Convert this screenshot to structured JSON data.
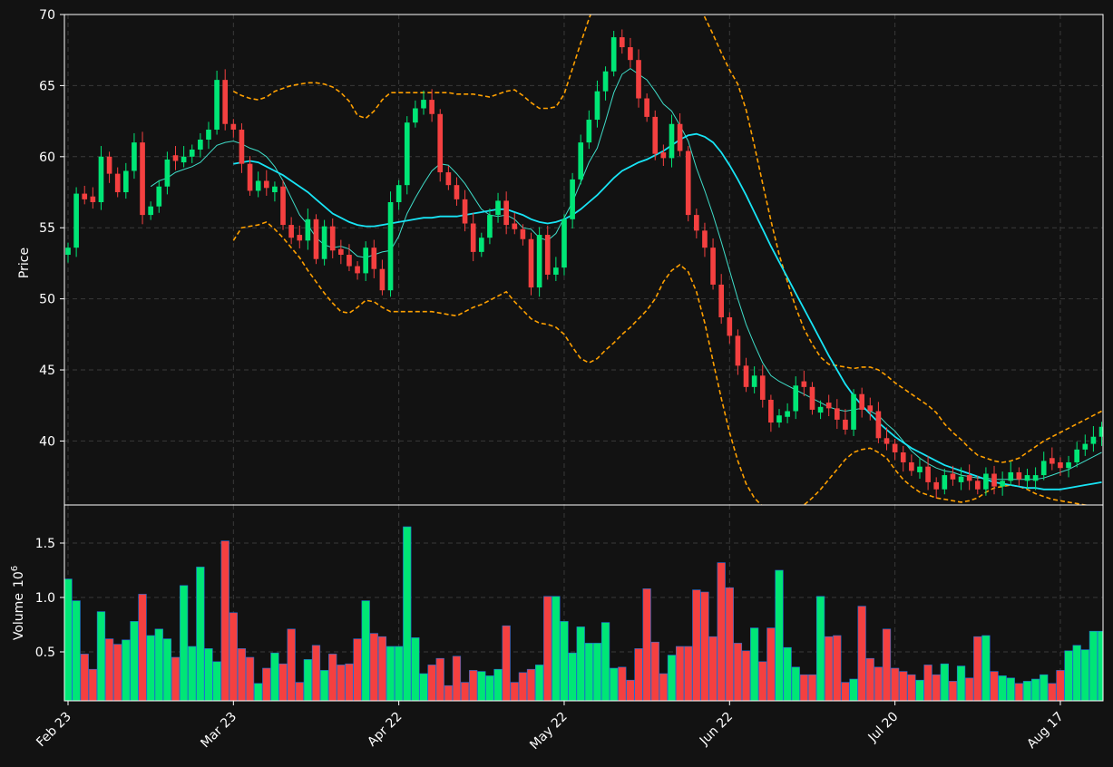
{
  "chart_data": {
    "type": "candlestick",
    "colors": {
      "background": "#121212",
      "axis": "#ffffff",
      "grid": "#3a3a3a",
      "up": "#00e676",
      "down": "#f44040",
      "ma_short": "#3fdcc8",
      "ma_long": "#18e4f5",
      "bands": "#ffa000",
      "volume_edge": "#1e6fd8"
    },
    "price_panel": {
      "ylabel": "Price",
      "ylim": [
        35.5,
        70
      ],
      "yticks": [
        40,
        45,
        50,
        55,
        60,
        65,
        70
      ]
    },
    "volume_panel": {
      "ylabel": "Volume",
      "unit_label": "10",
      "unit_exp": "6",
      "ylim": [
        0.05,
        1.85
      ],
      "yticks": [
        0.5,
        1.0,
        1.5
      ],
      "ytick_labels": [
        "0.5",
        "1.0",
        "1.5"
      ]
    },
    "xticks": [
      {
        "label": "Feb 23",
        "index": 0
      },
      {
        "label": "Mar 23",
        "index": 20
      },
      {
        "label": "Apr 22",
        "index": 40
      },
      {
        "label": "May 22",
        "index": 60
      },
      {
        "label": "Jun 22",
        "index": 80
      },
      {
        "label": "Jul 20",
        "index": 100
      },
      {
        "label": "Aug 17",
        "index": 120
      }
    ],
    "series_points": 126,
    "closes": [
      53.6,
      57.4,
      57.0,
      56.8,
      60.0,
      58.8,
      57.5,
      59.0,
      61.0,
      55.9,
      56.5,
      57.9,
      59.8,
      59.7,
      60.0,
      60.5,
      61.2,
      61.9,
      65.4,
      62.3,
      61.9,
      59.5,
      57.6,
      58.3,
      57.8,
      57.9,
      55.2,
      54.3,
      54.1,
      55.6,
      52.8,
      55.1,
      53.4,
      53.1,
      52.3,
      51.8,
      53.6,
      52.1,
      50.6,
      56.8,
      58.0,
      62.4,
      63.4,
      64.0,
      63.0,
      58.9,
      58.0,
      57.0,
      55.3,
      53.3,
      54.3,
      55.9,
      56.9,
      55.2,
      54.9,
      54.2,
      50.8,
      54.5,
      51.7,
      52.2,
      55.6,
      58.4,
      61.0,
      62.6,
      64.6,
      66.0,
      68.4,
      67.7,
      66.8,
      64.1,
      62.8,
      60.2,
      59.9,
      62.3,
      60.4,
      55.9,
      54.8,
      53.6,
      51.0,
      48.7,
      47.4,
      45.3,
      43.8,
      44.6,
      42.9,
      41.3,
      41.8,
      42.1,
      43.9,
      43.8,
      42.2,
      42.4,
      42.3,
      41.5,
      40.8,
      43.3,
      42.2,
      42.1,
      40.2,
      39.8,
      39.2,
      38.5,
      37.9,
      38.2,
      37.1,
      36.6,
      37.6,
      37.3,
      37.5,
      37.2,
      36.6,
      37.7,
      36.8,
      37.2,
      37.8,
      37.3,
      37.6,
      37.6,
      38.6,
      38.4,
      38.1,
      38.5,
      39.4,
      39.8,
      40.3,
      41.0
    ],
    "ma_short": [
      null,
      null,
      null,
      null,
      null,
      null,
      null,
      null,
      null,
      null,
      57.9,
      58.3,
      58.5,
      58.9,
      59.1,
      59.3,
      59.6,
      60.2,
      60.8,
      61.0,
      61.1,
      60.9,
      60.6,
      60.4,
      60.0,
      59.3,
      58.3,
      57.1,
      55.9,
      55.2,
      54.3,
      53.8,
      53.6,
      53.7,
      53.5,
      53.0,
      52.9,
      53.1,
      53.3,
      53.4,
      54.4,
      56.0,
      57.1,
      58.1,
      59.0,
      59.5,
      59.4,
      58.8,
      58.1,
      57.2,
      56.3,
      55.9,
      55.8,
      55.9,
      55.6,
      55.0,
      54.9,
      54.3,
      54.1,
      54.6,
      55.7,
      56.8,
      58.2,
      59.6,
      60.6,
      62.5,
      64.5,
      65.8,
      66.2,
      65.8,
      65.4,
      64.6,
      63.7,
      63.2,
      62.2,
      61.1,
      59.2,
      57.6,
      55.9,
      54.0,
      52.0,
      50.0,
      48.2,
      46.8,
      45.5,
      44.6,
      44.2,
      43.9,
      43.6,
      43.3,
      43.0,
      42.7,
      42.4,
      42.2,
      42.1,
      42.2,
      42.3,
      42.1,
      41.8,
      41.2,
      40.7,
      40.0,
      39.3,
      38.8,
      38.4,
      38.1,
      37.9,
      37.8,
      37.6,
      37.5,
      37.4,
      37.4,
      37.3,
      37.3,
      37.3,
      37.3,
      37.3,
      37.3,
      37.4,
      37.6,
      37.8,
      38.0,
      38.3,
      38.6,
      38.9,
      39.2
    ],
    "ma_long": [
      null,
      null,
      null,
      null,
      null,
      null,
      null,
      null,
      null,
      null,
      null,
      null,
      null,
      null,
      null,
      null,
      null,
      null,
      null,
      null,
      59.5,
      59.6,
      59.7,
      59.6,
      59.3,
      59.0,
      58.7,
      58.3,
      57.9,
      57.5,
      57.0,
      56.5,
      56.0,
      55.7,
      55.4,
      55.2,
      55.1,
      55.1,
      55.2,
      55.3,
      55.4,
      55.5,
      55.6,
      55.7,
      55.7,
      55.8,
      55.8,
      55.8,
      55.9,
      56.0,
      56.1,
      56.2,
      56.3,
      56.3,
      56.1,
      55.9,
      55.6,
      55.4,
      55.3,
      55.4,
      55.6,
      55.9,
      56.3,
      56.8,
      57.3,
      57.9,
      58.5,
      59.0,
      59.3,
      59.6,
      59.8,
      60.1,
      60.4,
      60.8,
      61.2,
      61.5,
      61.6,
      61.4,
      61.0,
      60.3,
      59.4,
      58.4,
      57.3,
      56.1,
      54.9,
      53.7,
      52.6,
      51.5,
      50.4,
      49.3,
      48.2,
      47.1,
      46.0,
      45.0,
      44.0,
      43.2,
      42.5,
      41.9,
      41.3,
      40.8,
      40.3,
      39.9,
      39.5,
      39.2,
      38.9,
      38.6,
      38.3,
      38.1,
      37.9,
      37.7,
      37.5,
      37.3,
      37.1,
      37.0,
      36.9,
      36.8,
      36.7,
      36.7,
      36.6,
      36.6,
      36.6,
      36.7,
      36.8,
      36.9,
      37.0,
      37.1
    ],
    "bb_upper": [
      null,
      null,
      null,
      null,
      null,
      null,
      null,
      null,
      null,
      null,
      null,
      null,
      null,
      null,
      null,
      null,
      null,
      null,
      null,
      null,
      64.6,
      64.3,
      64.1,
      64.0,
      64.2,
      64.6,
      64.8,
      65.0,
      65.1,
      65.2,
      65.2,
      65.1,
      64.9,
      64.5,
      63.9,
      62.9,
      62.7,
      63.2,
      64.0,
      64.5,
      64.5,
      64.5,
      64.5,
      64.5,
      64.5,
      64.5,
      64.5,
      64.4,
      64.4,
      64.4,
      64.3,
      64.2,
      64.4,
      64.6,
      64.7,
      64.3,
      63.8,
      63.4,
      63.4,
      63.5,
      64.4,
      66.2,
      68.0,
      69.7,
      71.2,
      72.6,
      73.8,
      74.8,
      75.6,
      76.1,
      76.3,
      76.2,
      75.8,
      75.1,
      74.1,
      72.8,
      71.3,
      69.8,
      68.6,
      67.3,
      66.1,
      65.1,
      63.3,
      60.8,
      58.1,
      55.5,
      53.1,
      51.2,
      49.4,
      47.9,
      46.8,
      45.9,
      45.4,
      45.3,
      45.2,
      45.1,
      45.2,
      45.2,
      45.0,
      44.6,
      44.1,
      43.7,
      43.3,
      42.9,
      42.5,
      42.0,
      41.2,
      40.6,
      40.1,
      39.5,
      39.0,
      38.8,
      38.6,
      38.5,
      38.6,
      38.8,
      39.2,
      39.6,
      40.0,
      40.3,
      40.6,
      40.9,
      41.2,
      41.5,
      41.8,
      42.1
    ],
    "bb_lower": [
      null,
      null,
      null,
      null,
      null,
      null,
      null,
      null,
      null,
      null,
      null,
      null,
      null,
      null,
      null,
      null,
      null,
      null,
      null,
      null,
      54.1,
      55.0,
      55.1,
      55.2,
      55.4,
      54.9,
      54.3,
      53.6,
      52.9,
      52.0,
      51.2,
      50.4,
      49.7,
      49.1,
      49.0,
      49.4,
      49.9,
      49.8,
      49.4,
      49.1,
      49.1,
      49.1,
      49.1,
      49.1,
      49.1,
      49.0,
      48.9,
      48.8,
      49.1,
      49.4,
      49.6,
      49.9,
      50.2,
      50.5,
      49.8,
      49.2,
      48.6,
      48.3,
      48.2,
      48.0,
      47.5,
      46.6,
      45.8,
      45.5,
      45.8,
      46.4,
      46.9,
      47.5,
      48.0,
      48.6,
      49.2,
      50.0,
      51.2,
      52.0,
      52.4,
      51.9,
      50.5,
      48.3,
      45.6,
      43.0,
      40.6,
      38.6,
      37.0,
      36.0,
      35.4,
      35.0,
      34.7,
      34.7,
      35.0,
      35.5,
      36.0,
      36.6,
      37.3,
      38.0,
      38.7,
      39.2,
      39.4,
      39.5,
      39.2,
      38.8,
      38.0,
      37.3,
      36.8,
      36.4,
      36.2,
      36.0,
      35.9,
      35.8,
      35.7,
      35.8,
      36.0,
      36.4,
      36.7,
      36.8,
      36.9,
      36.8,
      36.6,
      36.3,
      36.1,
      35.9,
      35.8,
      35.7,
      35.6,
      35.5,
      35.4,
      35.3
    ],
    "volumes": [
      1.17,
      0.97,
      0.48,
      0.34,
      0.87,
      0.62,
      0.57,
      0.61,
      0.78,
      1.03,
      0.65,
      0.71,
      0.62,
      0.45,
      1.11,
      0.55,
      1.28,
      0.53,
      0.41,
      1.52,
      0.86,
      0.53,
      0.45,
      0.21,
      0.35,
      0.49,
      0.39,
      0.71,
      0.22,
      0.43,
      0.56,
      0.33,
      0.48,
      0.38,
      0.39,
      0.62,
      0.97,
      0.67,
      0.64,
      0.55,
      0.55,
      1.65,
      0.63,
      0.3,
      0.38,
      0.44,
      0.19,
      0.46,
      0.22,
      0.33,
      0.32,
      0.28,
      0.34,
      0.74,
      0.22,
      0.31,
      0.34,
      0.38,
      1.01,
      1.01,
      0.78,
      0.49,
      0.73,
      0.58,
      0.58,
      0.77,
      0.35,
      0.36,
      0.24,
      0.53,
      1.08,
      0.59,
      0.3,
      0.47,
      0.55,
      0.55,
      1.07,
      1.05,
      0.64,
      1.32,
      1.09,
      0.58,
      0.51,
      0.72,
      0.41,
      0.72,
      1.25,
      0.54,
      0.36,
      0.29,
      0.29,
      1.01,
      0.64,
      0.65,
      0.22,
      0.25,
      0.92,
      0.44,
      0.36,
      0.71,
      0.35,
      0.32,
      0.29,
      0.24,
      0.38,
      0.29,
      0.39,
      0.23,
      0.37,
      0.26,
      0.64,
      0.65,
      0.32,
      0.28,
      0.26,
      0.21,
      0.23,
      0.25,
      0.29,
      0.21,
      0.33,
      0.51,
      0.56,
      0.52,
      0.69,
      0.69
    ]
  }
}
